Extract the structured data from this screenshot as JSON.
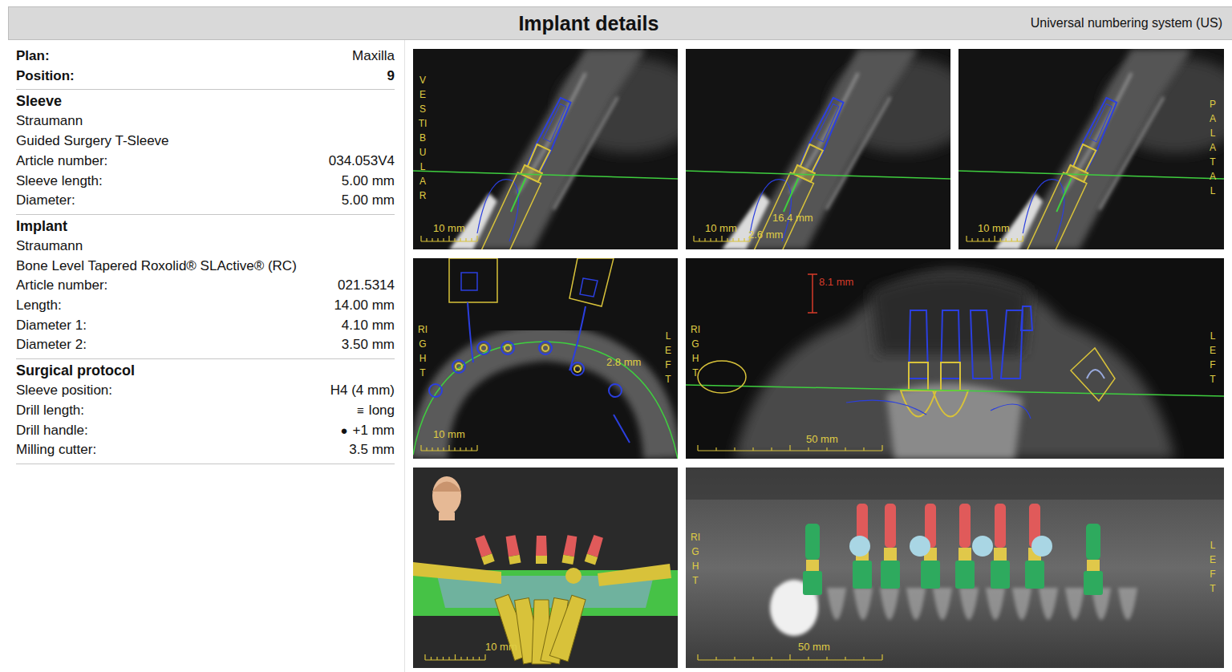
{
  "header": {
    "title": "Implant details",
    "numbering": "Universal numbering system (US)"
  },
  "sections": [
    {
      "title": "",
      "lines": [],
      "rows": [
        {
          "label": "Plan:",
          "value": "Maxilla",
          "kind": "key"
        },
        {
          "label": "Position:",
          "value": "9",
          "kind": "strong"
        }
      ]
    },
    {
      "title": "Sleeve",
      "lines": [
        "Straumann",
        "Guided Surgery T-Sleeve"
      ],
      "rows": [
        {
          "label": "Article number:",
          "value": "034.053V4"
        },
        {
          "label": "Sleeve length:",
          "value": "5.00 mm"
        },
        {
          "label": "Diameter:",
          "value": "5.00 mm"
        }
      ]
    },
    {
      "title": "Implant",
      "lines": [
        "Straumann",
        "Bone Level Tapered Roxolid® SLActive® (RC)"
      ],
      "rows": [
        {
          "label": "Article number:",
          "value": "021.5314"
        },
        {
          "label": "Length:",
          "value": "14.00 mm"
        },
        {
          "label": "Diameter 1:",
          "value": "4.10 mm"
        },
        {
          "label": "Diameter 2:",
          "value": "3.50 mm"
        }
      ]
    },
    {
      "title": "Surgical protocol",
      "lines": [],
      "rows": [
        {
          "label": "Sleeve position:",
          "value": "H4 (4 mm)"
        },
        {
          "label": "Drill length:",
          "icon": "≡",
          "value": "long"
        },
        {
          "label": "Drill handle:",
          "icon": "●",
          "value": "+1 mm"
        },
        {
          "label": "Milling cutter:",
          "value": "3.5 mm"
        }
      ]
    }
  ],
  "panels": [
    {
      "view": "cross-section",
      "labels": [
        {
          "text": "VESTIBULAR",
          "kind": "side",
          "color": "#e0cf45"
        },
        {
          "text": "10 mm",
          "kind": "scale",
          "color": "#e0cf45"
        }
      ]
    },
    {
      "view": "cross-section",
      "labels": [
        {
          "text": "10 mm",
          "kind": "scale",
          "color": "#e0cf45"
        },
        {
          "text": "16.4 mm",
          "kind": "measure",
          "color": "#e0cf45"
        },
        {
          "text": "2.6 mm",
          "kind": "measure",
          "color": "#e0cf45"
        }
      ]
    },
    {
      "view": "cross-section",
      "labels": [
        {
          "text": "PALATAL",
          "kind": "side",
          "color": "#e0cf45"
        },
        {
          "text": "10 mm",
          "kind": "scale",
          "color": "#e0cf45"
        }
      ]
    },
    {
      "view": "axial",
      "labels": [
        {
          "text": "RIGHT",
          "kind": "side",
          "color": "#e0cf45"
        },
        {
          "text": "LEFT",
          "kind": "side",
          "color": "#e0cf45"
        },
        {
          "text": "10 mm",
          "kind": "scale",
          "color": "#e0cf45"
        },
        {
          "text": "2.8 mm",
          "kind": "measure",
          "color": "#e0cf45"
        }
      ]
    },
    {
      "view": "coronal",
      "labels": [
        {
          "text": "RIGHT",
          "kind": "side",
          "color": "#e0cf45"
        },
        {
          "text": "LEFT",
          "kind": "side",
          "color": "#e0cf45"
        },
        {
          "text": "8.1 mm",
          "kind": "measure",
          "color": "#d63b2a"
        },
        {
          "text": "50 mm",
          "kind": "scale",
          "color": "#e0cf45"
        }
      ]
    },
    {
      "view": "3d",
      "labels": [
        {
          "text": "10 mm",
          "kind": "scale",
          "color": "#e0cf45"
        }
      ]
    },
    {
      "view": "panoramic",
      "labels": [
        {
          "text": "RIGHT",
          "kind": "side",
          "color": "#e0cf45"
        },
        {
          "text": "LEFT",
          "kind": "side",
          "color": "#e0cf45"
        },
        {
          "text": "50 mm",
          "kind": "scale",
          "color": "#e0cf45"
        }
      ]
    }
  ]
}
